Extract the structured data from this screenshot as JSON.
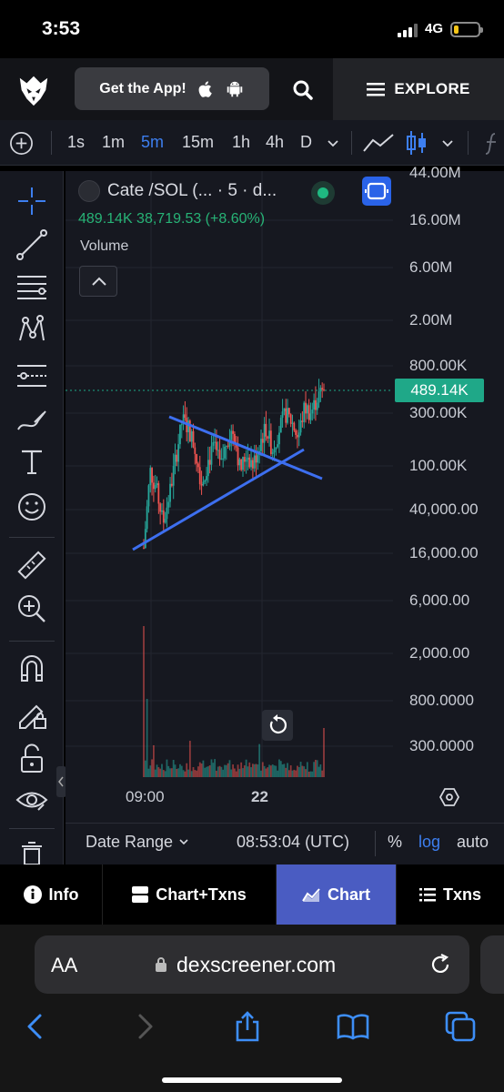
{
  "status_bar": {
    "time": "3:53",
    "network": "4G"
  },
  "header": {
    "get_app_label": "Get the App!",
    "explore_label": "EXPLORE"
  },
  "toolbar": {
    "timeframes": [
      "1s",
      "1m",
      "5m",
      "15m",
      "1h",
      "4h",
      "D"
    ],
    "active_timeframe": "5m"
  },
  "chart": {
    "title": "Cate /SOL (... · 5 · d...",
    "ohlc": "489.14K  38,719.53 (+8.60%)",
    "volume_label": "Volume",
    "current_price_tag": "489.14K",
    "price_axis": [
      "44.00M",
      "16.00M",
      "6.00M",
      "2.00M",
      "800.00K",
      "300.00K",
      "100.00K",
      "40,000.00",
      "16,000.00",
      "6,000.00",
      "2,000.00",
      "800.0000",
      "300.0000"
    ],
    "time_axis": [
      "09:00",
      "22"
    ],
    "colors": {
      "up": "#26a69a",
      "down": "#ef5350",
      "trendline": "#3d6ff0",
      "price_tag": "#1fa888"
    }
  },
  "chart_data": {
    "type": "line",
    "title": "Cate /SOL (... · 5 · d...",
    "scale": "log",
    "x_ticks": [
      "09:00",
      "22"
    ],
    "y_ticks": [
      "44.00M",
      "16.00M",
      "6.00M",
      "2.00M",
      "800.00K",
      "300.00K",
      "100.00K",
      "40,000.00",
      "16,000.00",
      "6,000.00",
      "2,000.00",
      "800.0000",
      "300.0000"
    ],
    "last_value": 489140,
    "change": 38719.53,
    "change_pct": 8.6,
    "series": [
      {
        "values": [
          18000,
          90000,
          60000,
          30000,
          55000,
          120000,
          260000,
          220000,
          140000,
          70000,
          110000,
          150000,
          95000,
          180000,
          210000,
          90000,
          130000,
          100000,
          160000,
          220000,
          140000,
          210000,
          300000,
          250000,
          180000,
          340000,
          300000,
          420000,
          489140
        ]
      }
    ],
    "grid": true,
    "legend": "none"
  },
  "bottom_bar": {
    "date_range_label": "Date Range",
    "time_utc": "08:53:04 (UTC)",
    "percent_label": "%",
    "log_label": "log",
    "auto_label": "auto"
  },
  "tabs": [
    {
      "label": "Info",
      "active": false
    },
    {
      "label": "Chart+Txns",
      "active": false
    },
    {
      "label": "Chart",
      "active": true
    },
    {
      "label": "Txns",
      "active": false
    }
  ],
  "browser": {
    "aa_label": "AA",
    "url": "dexscreener.com"
  }
}
